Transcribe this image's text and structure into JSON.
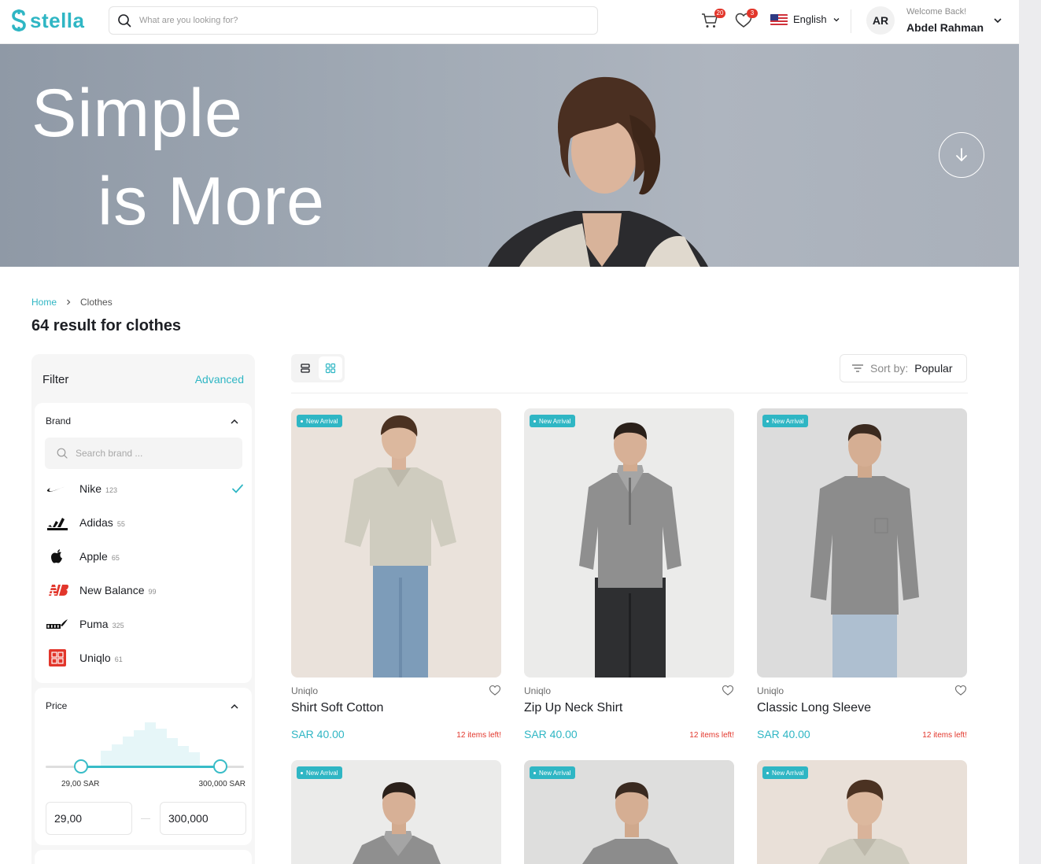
{
  "header": {
    "logo_text": "stella",
    "search_placeholder": "What are you looking for?",
    "cart_count": "20",
    "wishlist_count": "3",
    "language": "English",
    "user_initials": "AR",
    "welcome_text": "Welcome Back!",
    "user_name": "Abdel Rahman"
  },
  "hero": {
    "line1": "Simple",
    "line2": "is More"
  },
  "breadcrumb": {
    "home": "Home",
    "current": "Clothes"
  },
  "results_title": "64 result for clothes",
  "filter": {
    "title": "Filter",
    "advanced": "Advanced",
    "brand": {
      "title": "Brand",
      "search_placeholder": "Search brand ...",
      "items": [
        {
          "name": "Nike",
          "count": "123",
          "logo": "nike-logo",
          "checked": true
        },
        {
          "name": "Adidas",
          "count": "55",
          "logo": "adidas-logo",
          "checked": false
        },
        {
          "name": "Apple",
          "count": "65",
          "logo": "apple-logo",
          "checked": false
        },
        {
          "name": "New Balance",
          "count": "99",
          "logo": "new-balance-logo",
          "checked": false
        },
        {
          "name": "Puma",
          "count": "325",
          "logo": "puma-logo",
          "checked": false
        },
        {
          "name": "Uniqlo",
          "count": "61",
          "logo": "uniqlo-logo",
          "checked": false
        }
      ]
    },
    "price": {
      "title": "Price",
      "min_label": "29,00 SAR",
      "max_label": "300,000 SAR",
      "min_value": "29,00",
      "max_value": "300,000",
      "range_fraction": [
        0.18,
        0.88
      ]
    }
  },
  "toolbar": {
    "sort_label": "Sort by:",
    "sort_value": "Popular"
  },
  "products": [
    {
      "badge": "New Arrival",
      "brand": "Uniqlo",
      "name": "Shirt Soft Cotton",
      "price": "SAR 40.00",
      "stock": "12 items left!"
    },
    {
      "badge": "New Arrival",
      "brand": "Uniqlo",
      "name": "Zip Up Neck Shirt",
      "price": "SAR 40.00",
      "stock": "12 items left!"
    },
    {
      "badge": "New Arrival",
      "brand": "Uniqlo",
      "name": "Classic Long Sleeve",
      "price": "SAR 40.00",
      "stock": "12 items left!"
    },
    {
      "badge": "New Arrival"
    },
    {
      "badge": "New Arrival"
    },
    {
      "badge": "New Arrival"
    }
  ],
  "colors": {
    "accent": "#2fb6c4",
    "alert": "#e2362b"
  }
}
